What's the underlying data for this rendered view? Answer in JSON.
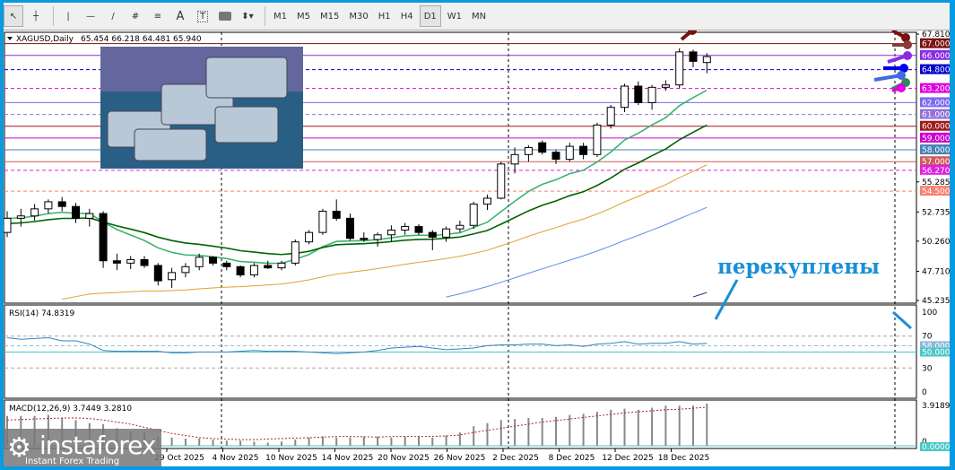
{
  "toolbar": {
    "tools": [
      "cursor-icon",
      "crosshair-icon",
      "vertical-line-icon",
      "horizontal-line-icon",
      "trendline-icon",
      "fibonacci-icon",
      "fibo-levels-icon",
      "text-icon",
      "text-label-icon",
      "rectangle-icon",
      "arrows-icon"
    ],
    "text_tool": "A",
    "timeframes": [
      "M1",
      "M5",
      "M15",
      "M30",
      "H1",
      "H4",
      "D1",
      "W1",
      "MN"
    ],
    "active_timeframe": "D1"
  },
  "header": {
    "symbol": "XAGUSD,Daily",
    "ohlc": "65.454 66.218 64.481 65.940"
  },
  "price_axis": {
    "ticks": [
      "67.810",
      "55.285",
      "52.735",
      "50.260",
      "47.710",
      "45.235"
    ],
    "tick_values": [
      67.81,
      55.285,
      52.735,
      50.26,
      47.71,
      45.235
    ]
  },
  "levels": [
    {
      "label": "67.000",
      "value": 67.0,
      "color": "#7a1010",
      "dash": false
    },
    {
      "label": "66.000",
      "value": 66.0,
      "color": "#8a2be2",
      "dash": false
    },
    {
      "label": "64.800",
      "value": 64.8,
      "color": "#0000cc",
      "dash": true
    },
    {
      "label": "63.200",
      "value": 63.2,
      "color": "#e000e0",
      "dash": true
    },
    {
      "label": "62.000",
      "value": 62.0,
      "color": "#7b68ee",
      "dash": false
    },
    {
      "label": "61.000",
      "value": 61.0,
      "color": "#9370db",
      "dash": true
    },
    {
      "label": "60.000",
      "value": 60.0,
      "color": "#a01818",
      "dash": false
    },
    {
      "label": "59.000",
      "value": 59.0,
      "color": "#d000d0",
      "dash": false
    },
    {
      "label": "58.000",
      "value": 58.0,
      "color": "#4682b4",
      "dash": false
    },
    {
      "label": "57.000",
      "value": 57.0,
      "color": "#cd5c5c",
      "dash": false
    },
    {
      "label": "56.270",
      "value": 56.27,
      "color": "#e020e0",
      "dash": true
    },
    {
      "label": "54.500",
      "value": 54.5,
      "color": "#fa8072",
      "dash": true
    }
  ],
  "candles": [
    [
      51.0,
      52.8,
      50.6,
      52.2
    ],
    [
      52.2,
      53.0,
      51.5,
      52.4
    ],
    [
      52.4,
      53.4,
      52.0,
      53.0
    ],
    [
      53.0,
      53.8,
      52.6,
      53.6
    ],
    [
      53.6,
      54.0,
      52.8,
      53.2
    ],
    [
      53.2,
      53.5,
      51.8,
      52.2
    ],
    [
      52.2,
      53.0,
      51.5,
      52.6
    ],
    [
      52.6,
      52.8,
      48.0,
      48.6
    ],
    [
      48.6,
      49.2,
      47.8,
      48.4
    ],
    [
      48.4,
      49.0,
      47.9,
      48.7
    ],
    [
      48.7,
      49.0,
      48.0,
      48.2
    ],
    [
      48.2,
      48.4,
      46.5,
      46.9
    ],
    [
      47.0,
      48.0,
      46.3,
      47.6
    ],
    [
      47.6,
      48.4,
      47.2,
      48.1
    ],
    [
      48.1,
      49.2,
      47.8,
      48.9
    ],
    [
      48.9,
      49.0,
      48.2,
      48.4
    ],
    [
      48.4,
      48.6,
      47.8,
      48.1
    ],
    [
      48.1,
      48.2,
      47.2,
      47.4
    ],
    [
      47.4,
      48.4,
      47.2,
      48.2
    ],
    [
      48.2,
      48.6,
      47.9,
      48.0
    ],
    [
      48.0,
      48.6,
      47.8,
      48.4
    ],
    [
      48.4,
      50.4,
      48.2,
      50.2
    ],
    [
      50.2,
      51.2,
      50.0,
      51.0
    ],
    [
      51.0,
      53.0,
      50.8,
      52.8
    ],
    [
      52.8,
      53.8,
      52.0,
      52.2
    ],
    [
      52.2,
      52.6,
      50.3,
      50.5
    ],
    [
      50.5,
      51.0,
      50.2,
      50.4
    ],
    [
      50.4,
      51.0,
      49.8,
      50.8
    ],
    [
      50.8,
      51.6,
      50.2,
      51.2
    ],
    [
      51.2,
      51.8,
      50.8,
      51.5
    ],
    [
      51.5,
      51.7,
      50.8,
      51.0
    ],
    [
      51.0,
      51.2,
      49.5,
      50.6
    ],
    [
      50.6,
      51.5,
      50.2,
      51.3
    ],
    [
      51.3,
      52.0,
      51.0,
      51.6
    ],
    [
      51.6,
      53.6,
      51.3,
      53.4
    ],
    [
      53.4,
      54.2,
      52.9,
      53.9
    ],
    [
      53.9,
      57.0,
      53.8,
      56.8
    ],
    [
      56.8,
      58.2,
      56.0,
      57.6
    ],
    [
      57.6,
      58.4,
      57.0,
      58.2
    ],
    [
      58.6,
      58.8,
      57.6,
      57.8
    ],
    [
      57.8,
      58.0,
      56.8,
      57.2
    ],
    [
      57.2,
      58.6,
      57.0,
      58.3
    ],
    [
      58.3,
      58.6,
      57.2,
      57.6
    ],
    [
      57.6,
      60.3,
      57.4,
      60.1
    ],
    [
      60.1,
      61.8,
      59.8,
      61.6
    ],
    [
      61.6,
      63.6,
      61.2,
      63.4
    ],
    [
      63.4,
      63.8,
      61.8,
      62.0
    ],
    [
      62.0,
      63.5,
      61.4,
      63.3
    ],
    [
      63.3,
      63.9,
      63.0,
      63.5
    ],
    [
      63.5,
      66.6,
      63.2,
      66.3
    ],
    [
      66.3,
      66.5,
      65.0,
      65.5
    ],
    [
      65.4,
      66.2,
      64.5,
      65.9
    ]
  ],
  "moving_averages": [
    {
      "period": 10,
      "color": "#3cb371"
    },
    {
      "period": 20,
      "color": "#006400"
    },
    {
      "period": 50,
      "color": "#e0a030"
    },
    {
      "period": 100,
      "color": "#5b8ee6"
    },
    {
      "period": 200,
      "color": "#1a1a8c"
    }
  ],
  "rsi": {
    "label": "RSI(14) 74.8319",
    "ticks": [
      "100",
      "70",
      "30",
      "0"
    ],
    "levels": [
      {
        "label": "58.0000",
        "value": 58
      },
      {
        "label": "50.0000",
        "value": 50
      }
    ],
    "values": [
      68,
      66,
      67,
      68,
      64,
      64,
      60,
      52,
      51,
      51,
      51,
      51,
      49,
      49,
      50,
      50,
      50,
      51,
      52,
      51,
      51,
      51,
      50,
      49,
      48,
      49,
      50,
      52,
      55,
      56,
      57,
      55,
      53,
      54,
      55,
      58,
      59,
      59,
      60,
      60,
      58,
      59,
      57,
      60,
      61,
      63,
      60,
      61,
      61,
      63,
      60,
      61
    ]
  },
  "macd": {
    "label": "MACD(12,26,9) 3.7449 3.2810",
    "ticks": [
      "3.9189",
      "0"
    ],
    "zero_label": "0.0000",
    "hist": [
      2.9,
      2.9,
      2.9,
      3.0,
      2.7,
      2.5,
      2.2,
      2.1,
      1.7,
      1.4,
      1.3,
      0.9,
      0.8,
      0.7,
      0.7,
      0.6,
      0.5,
      0.5,
      0.4,
      0.3,
      0.4,
      0.6,
      0.8,
      0.9,
      0.8,
      0.8,
      0.9,
      0.9,
      0.8,
      0.9,
      0.9,
      0.8,
      1.0,
      1.3,
      1.9,
      2.2,
      2.5,
      2.6,
      2.7,
      2.7,
      2.8,
      3.0,
      3.1,
      3.3,
      3.5,
      3.6,
      3.5,
      3.7,
      3.9,
      3.9,
      3.9,
      4.1
    ],
    "signal": [
      2.5,
      2.55,
      2.6,
      2.65,
      2.7,
      2.7,
      2.65,
      2.5,
      2.3,
      2.1,
      1.8,
      1.5,
      1.2,
      1.0,
      0.8,
      0.7,
      0.65,
      0.6,
      0.6,
      0.65,
      0.7,
      0.75,
      0.78,
      0.85,
      0.9,
      0.9,
      0.88,
      0.85,
      0.9,
      0.9,
      0.9,
      0.92,
      0.95,
      1.05,
      1.3,
      1.5,
      1.7,
      1.9,
      2.1,
      2.3,
      2.45,
      2.6,
      2.75,
      2.9,
      3.05,
      3.2,
      3.3,
      3.4,
      3.5,
      3.55,
      3.65,
      3.75
    ]
  },
  "dates": [
    "29 Oct 2025",
    "4 Nov 2025",
    "10 Nov 2025",
    "14 Nov 2025",
    "20 Nov 2025",
    "26 Nov 2025",
    "2 Dec 2025",
    "8 Dec 2025",
    "12 Dec 2025",
    "18 Dec 2025"
  ],
  "annotation": "перекуплены",
  "logo": {
    "name": "instaforex",
    "tagline": "Instant Forex Trading"
  },
  "colors": {
    "bull": "#ffffff",
    "bear": "#000000",
    "accent": "#0a9ae0",
    "note": "#1a8fd6"
  }
}
